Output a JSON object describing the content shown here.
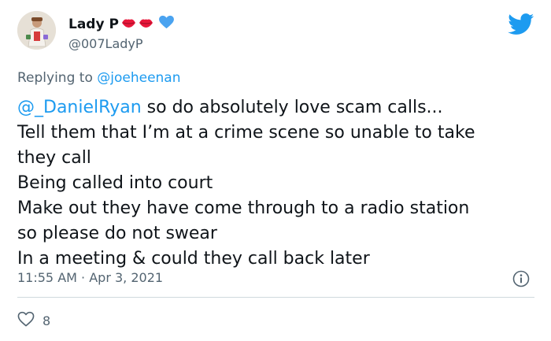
{
  "user": {
    "display_name": "Lady P",
    "handle": "@007LadyP",
    "avatar": "user-avatar-photo",
    "emojis": [
      "kiss-mark-icon",
      "kiss-mark-icon"
    ],
    "verified": "verified-heart-badge"
  },
  "replying": {
    "prefix": "Replying to",
    "to": "@joeheenan"
  },
  "tweet": {
    "mention": "@_DanielRyan",
    "line1_rest": " so do absolutely love scam calls...",
    "lines": [
      "Tell them that I’m at a crime scene so unable to take",
      "they call",
      "Being called into court",
      "Make out they have come through to a radio station",
      "so please do not swear",
      "In a meeting & could they call back later"
    ]
  },
  "meta": {
    "time": "11:55 AM",
    "separator": "·",
    "date": "Apr 3, 2021"
  },
  "likes": {
    "count": "8"
  },
  "colors": {
    "link": "#1d9bf0",
    "muted": "#536471",
    "text": "#0f1419",
    "twitter_blue": "#1d9bf0",
    "heart_badge": "#4aa3f0",
    "lips": "#e8173a"
  }
}
